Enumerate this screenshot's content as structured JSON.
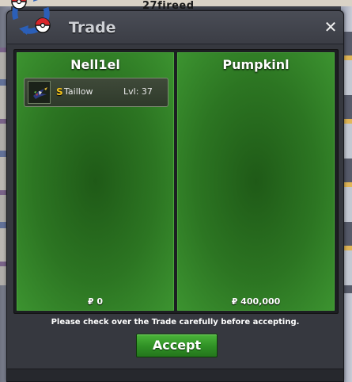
{
  "background": {
    "overhead_text": "27fireed"
  },
  "window": {
    "title": "Trade",
    "close_glyph": "✕",
    "logo_icon": "pokeball-trade-icon"
  },
  "left_panel": {
    "player_name": "Nell1el",
    "items": [
      {
        "shiny_marker": "S",
        "name": "Taillow",
        "level": "Lvl: 37",
        "icon": "taillow-sprite-icon"
      }
    ],
    "money": "₽ 0"
  },
  "right_panel": {
    "player_name": "Pumpkinl",
    "money": "₽ 400,000"
  },
  "notice_text": "Please check over the Trade carefully before accepting.",
  "accept_label": "Accept",
  "colors": {
    "panel_green": "#2c7522",
    "accept_green": "#2f8f25",
    "shiny_gold": "#f2c21a"
  }
}
